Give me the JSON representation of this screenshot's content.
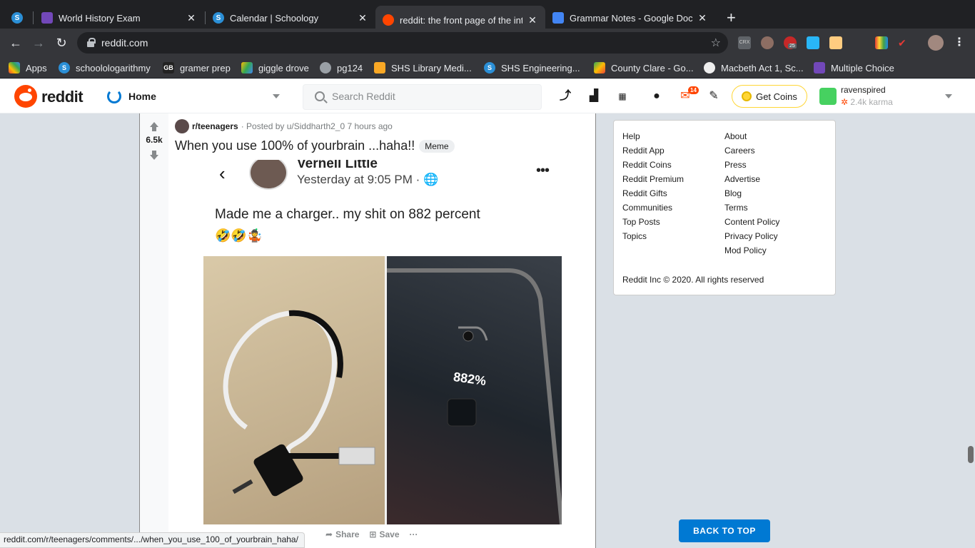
{
  "browser": {
    "tabs": [
      {
        "title": "World History Exam",
        "icon": "forms-icon",
        "color": "#7248b9"
      },
      {
        "title": "Calendar | Schoology",
        "icon": "schoology-icon",
        "color": "#2b8fd6"
      },
      {
        "title": "reddit: the front page of the int",
        "icon": "reddit-icon",
        "color": "#ff4500"
      },
      {
        "title": "Grammar Notes - Google Docs",
        "icon": "docs-icon",
        "color": "#4285f4"
      }
    ],
    "new_tab": "+",
    "url": "reddit.com",
    "bookmarks": [
      {
        "label": "Apps",
        "icon": "apps-grid-icon"
      },
      {
        "label": "schoolologarithmy",
        "icon": "schoology-icon"
      },
      {
        "label": "gramer prep",
        "icon": "gb-icon"
      },
      {
        "label": "giggle drove",
        "icon": "drive-icon"
      },
      {
        "label": "pg124",
        "icon": "globe-icon"
      },
      {
        "label": "SHS Library Medi...",
        "icon": "bookmark-icon"
      },
      {
        "label": "SHS Engineering...",
        "icon": "schoology-icon"
      },
      {
        "label": "County Clare - Go...",
        "icon": "maps-icon"
      },
      {
        "label": "Macbeth Act 1, Sc...",
        "icon": "site-icon"
      },
      {
        "label": "Multiple Choice",
        "icon": "forms-icon"
      }
    ],
    "extensions": [
      "CRX",
      "25"
    ],
    "status_url": "reddit.com/r/teenagers/comments/.../when_you_use_100_of_yourbrain_haha/"
  },
  "reddit": {
    "wordmark": "reddit",
    "home_label": "Home",
    "search_placeholder": "Search Reddit",
    "mail_badge": "14",
    "get_coins": "Get Coins",
    "username": "ravenspired",
    "karma": "2.4k karma"
  },
  "post": {
    "score": "6.5k",
    "subreddit": "r/teenagers",
    "posted_by": "· Posted by u/Siddharth2_0 7 hours ago",
    "title": "When you use 100% of yourbrain ...haha!!",
    "flair": "Meme",
    "image": {
      "fb_name": "Vernell Little",
      "fb_time": "Yesterday at 9:05 PM · 🌐",
      "fb_text": "Made me a charger.. my shit on 882 percent",
      "fb_emoji": "🤣🤣🤹",
      "phone_label": "882%"
    },
    "actions": {
      "share": "Share",
      "save": "Save",
      "more": "···"
    }
  },
  "sidebar": {
    "left_links": [
      "Help",
      "Reddit App",
      "Reddit Coins",
      "Reddit Premium",
      "Reddit Gifts",
      "Communities",
      "Top Posts",
      "Topics"
    ],
    "right_links": [
      "About",
      "Careers",
      "Press",
      "Advertise",
      "Blog",
      "Terms",
      "Content Policy",
      "Privacy Policy",
      "Mod Policy"
    ],
    "copyright": "Reddit Inc © 2020. All rights reserved"
  },
  "back_to_top": "BACK TO TOP"
}
